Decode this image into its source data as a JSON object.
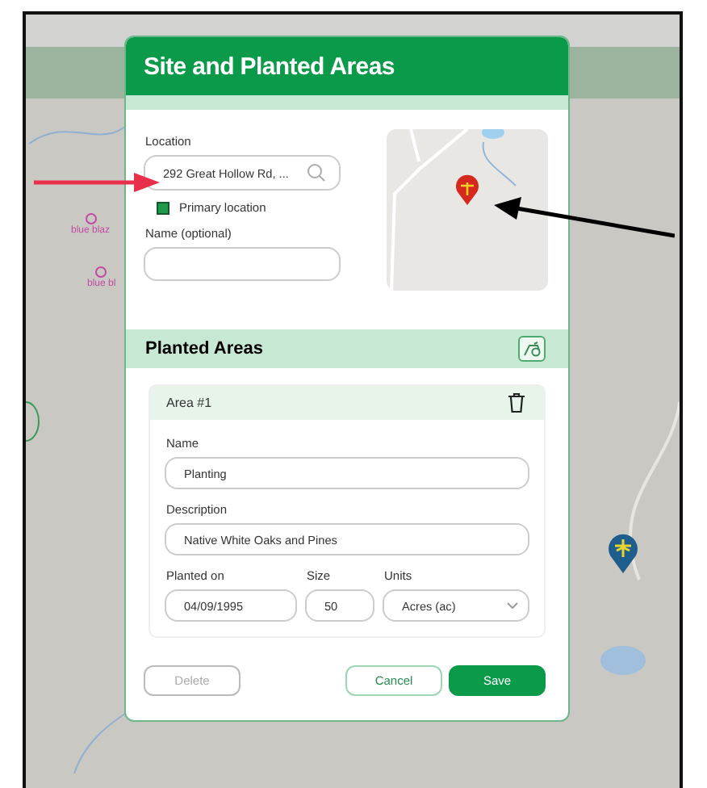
{
  "map": {
    "labels": [
      "blue blaz",
      "blue bl"
    ]
  },
  "dialog": {
    "title": "Site and Planted Areas",
    "site": {
      "location_label": "Location",
      "location_value": "292 Great Hollow Rd, ...",
      "primary": {
        "label": "Primary location",
        "checked": true
      },
      "name_label": "Name (optional)"
    },
    "planted": {
      "title": "Planted Areas",
      "areas": [
        {
          "title": "Area #1",
          "name_label": "Name",
          "name_value": "Planting",
          "description_label": "Description",
          "description_value": "Native White Oaks and Pines",
          "planted_label": "Planted on",
          "planted_value": "04/09/1995",
          "size_label": "Size",
          "size_value": "50",
          "units_label": "Units",
          "units_value": "Acres (ac)"
        }
      ]
    },
    "buttons": [
      {
        "label": "Delete",
        "kind": "disabled"
      },
      {
        "label": "Cancel",
        "kind": "outline"
      },
      {
        "label": "Save",
        "kind": "primary"
      }
    ]
  }
}
